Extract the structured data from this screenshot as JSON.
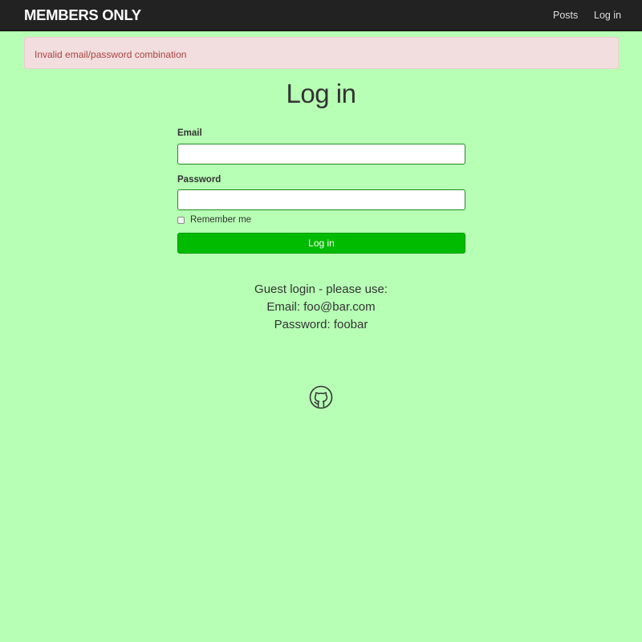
{
  "navbar": {
    "brand": "MEMBERS ONLY",
    "links": [
      "Posts",
      "Log in"
    ]
  },
  "alert": {
    "message": "Invalid email/password combination"
  },
  "form": {
    "title": "Log in",
    "email_label": "Email",
    "email_value": "",
    "password_label": "Password",
    "password_value": "",
    "remember_label": "Remember me",
    "remember_checked": false,
    "submit_label": "Log in"
  },
  "guest": {
    "line1": "Guest login - please use:",
    "line2": "Email: foo@bar.com",
    "line3": "Password: foobar"
  },
  "footer": {
    "icon": "github-icon"
  },
  "colors": {
    "background": "#b7ffb5",
    "navbar": "#222222",
    "alert_bg": "#f2dede",
    "alert_text": "#a94442",
    "button": "#00bb00",
    "input_border": "#1c8c1c"
  }
}
